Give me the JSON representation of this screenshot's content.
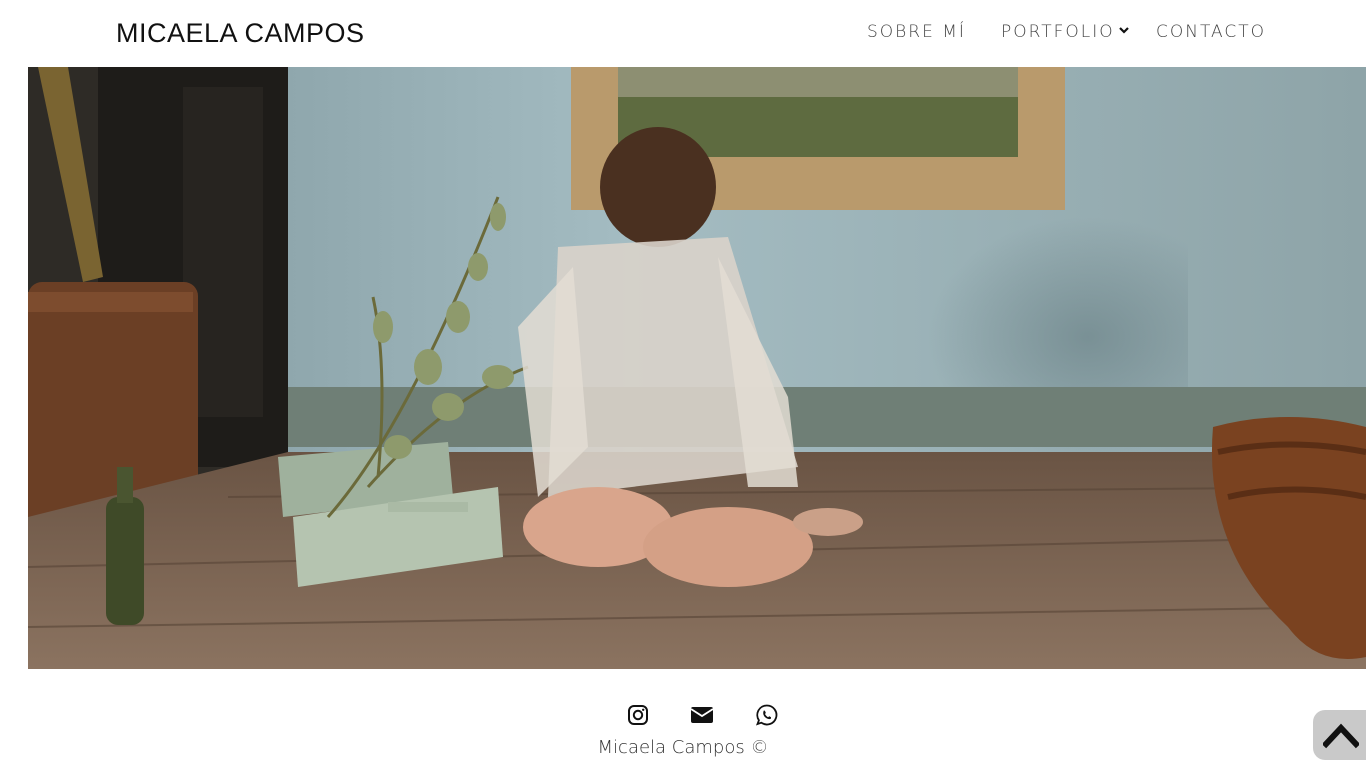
{
  "header": {
    "brand": "MICAELA CAMPOS",
    "nav": {
      "about": "SOBRE MÍ",
      "portfolio": "PORTFOLIO",
      "contact": "CONTACTO"
    }
  },
  "hero": {
    "icon": "photograph"
  },
  "footer": {
    "social": [
      "instagram-icon",
      "envelope-icon",
      "whatsapp-icon"
    ],
    "copyright": "Micaela Campos ©"
  },
  "scroll_top": {
    "icon": "chevron-up-icon"
  }
}
